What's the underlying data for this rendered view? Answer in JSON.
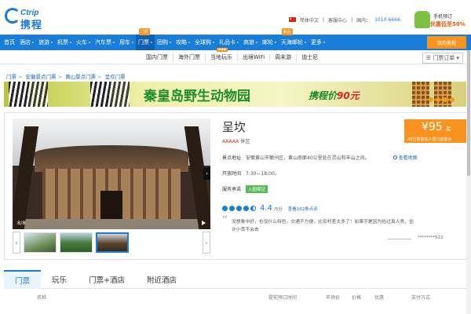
{
  "header": {
    "logo_en": "Ctrip",
    "logo_cn": "携程",
    "language": "简体中文",
    "help": "客服中心",
    "phone_label": "国内：",
    "phone": "1010-6666",
    "promo_line1": "手机预订",
    "promo_line2": "优惠低至50%"
  },
  "nav": {
    "items": [
      {
        "label": "首页"
      },
      {
        "label": "酒店"
      },
      {
        "label": "旅游"
      },
      {
        "label": "机票"
      },
      {
        "label": "火车"
      },
      {
        "label": "汽车票"
      },
      {
        "label": "用车"
      },
      {
        "label": "门票",
        "badge": "门票"
      },
      {
        "label": "团购"
      },
      {
        "label": "攻略"
      },
      {
        "label": "全球购"
      },
      {
        "label": "礼品卡"
      },
      {
        "label": "商旅"
      },
      {
        "label": "邮轮"
      },
      {
        "label": "天海邮轮",
        "badge": "新品"
      },
      {
        "label": "更多"
      }
    ],
    "my_ctrip": "我的携程"
  },
  "subnav": {
    "items": [
      "国内门票",
      "海外门票",
      "当地玩乐",
      "出境WiFi",
      "周末游",
      "迪士尼"
    ],
    "new_badge": "new",
    "orders": "门票订单"
  },
  "breadcrumb": [
    "门票",
    "安徽景点门票",
    "黄山景点门票",
    "呈坎门票"
  ],
  "banner": {
    "title": "秦皇岛野生动物园",
    "price_prefix": "携程价",
    "price": "90元"
  },
  "attraction": {
    "name": "呈坎",
    "grade": "AAAAA",
    "grade_suffix": "景区",
    "price": "¥95",
    "price_unit": "起",
    "price_note": "45分钟前有人预订该景点",
    "address_label": "景点地址",
    "address": "安徽黄山市徽州区，黄山南面40公里处在灵山和丰山之间。",
    "map_link": "查看地图",
    "hours_label": "开放时间",
    "hours": "7:30—18:00。",
    "service_label": "服务承诺",
    "service_tag": "入园保证",
    "rating": "4.4",
    "rating_out_of": "/5分",
    "reviews": "查看162条点评",
    "quote": "没想象中好，也没什么特色，交通不方便，比宏村差太多了！如果不是因为抬过真人秀，估计小丢不会去",
    "reviewer": "********522",
    "photo_counter": "8/8"
  },
  "tabs": [
    "门票",
    "玩乐",
    "门票+酒店",
    "附近酒店"
  ],
  "table_headers": [
    "名称",
    "提前预订时间",
    "市场价",
    "价格",
    "优惠",
    "支付方式"
  ],
  "colors": {
    "brand_blue": "#1a7ed6",
    "orange": "#f7931e",
    "green": "#1f8d2c",
    "red": "#e2231a"
  }
}
